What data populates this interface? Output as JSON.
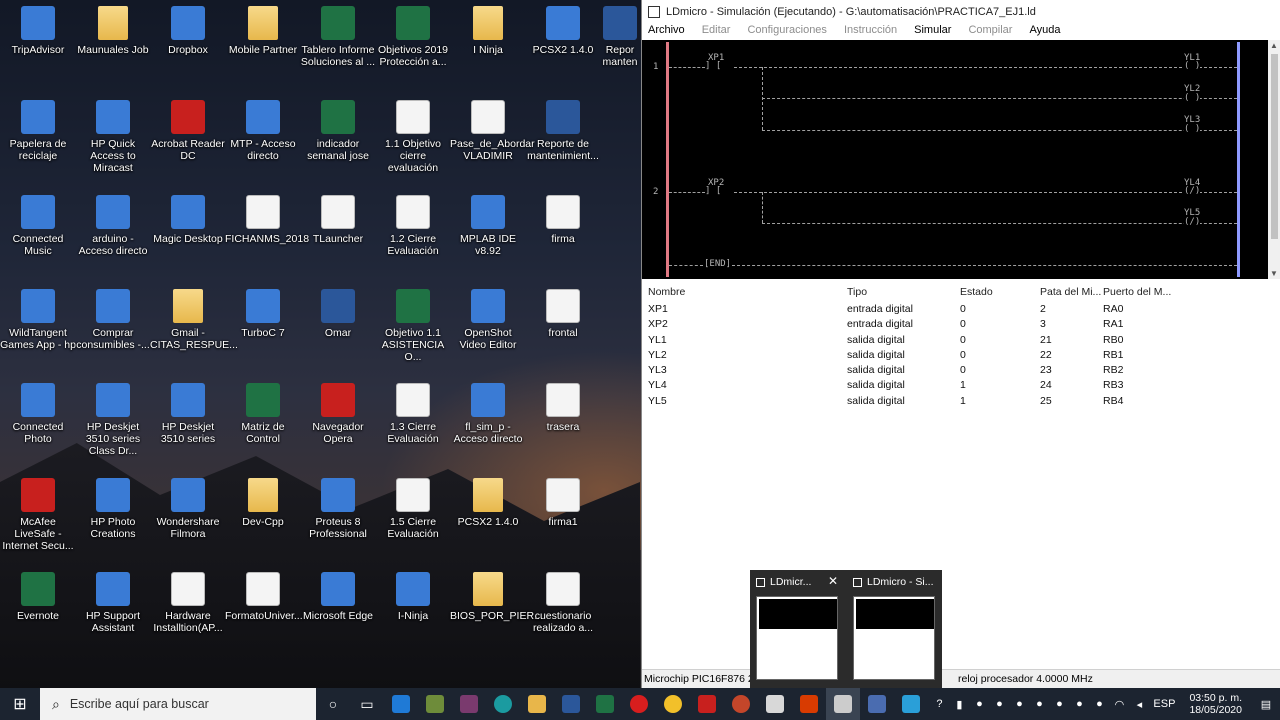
{
  "desktop": {
    "icons": [
      {
        "label": "TripAdvisor"
      },
      {
        "label": "Maunuales Job"
      },
      {
        "label": "Dropbox"
      },
      {
        "label": "Mobile Partner"
      },
      {
        "label": "Tablero Informe Soluciones al ..."
      },
      {
        "label": "Objetivos 2019 Protección a..."
      },
      {
        "label": "I Ninja"
      },
      {
        "label": "PCSX2 1.4.0"
      },
      {
        "label": "Repor manten"
      },
      {
        "label": "Papelera de reciclaje"
      },
      {
        "label": "HP Quick Access to Miracast"
      },
      {
        "label": "Acrobat Reader DC"
      },
      {
        "label": "MTP - Acceso directo"
      },
      {
        "label": "indicador semanal jose"
      },
      {
        "label": "1.1 Objetivo cierre evaluación"
      },
      {
        "label": "Pase_de_Abordar VLADIMIR"
      },
      {
        "label": "Reporte de mantenimient..."
      },
      {
        "label": "Connected Music"
      },
      {
        "label": "arduino - Acceso directo"
      },
      {
        "label": "Magic Desktop"
      },
      {
        "label": "FICHANMS_2018"
      },
      {
        "label": "TLauncher"
      },
      {
        "label": "1.2 Cierre Evaluación"
      },
      {
        "label": "MPLAB IDE v8.92"
      },
      {
        "label": "firma"
      },
      {
        "label": "WildTangent Games App - hp"
      },
      {
        "label": "Comprar consumibles -..."
      },
      {
        "label": "Gmail - CITAS_RESPUE..."
      },
      {
        "label": "TurboC 7"
      },
      {
        "label": "Omar"
      },
      {
        "label": "Objetivo 1.1 ASISTENCIA O..."
      },
      {
        "label": "OpenShot Video Editor"
      },
      {
        "label": "frontal"
      },
      {
        "label": "Connected Photo"
      },
      {
        "label": "HP Deskjet 3510 series Class Dr..."
      },
      {
        "label": "HP Deskjet 3510 series"
      },
      {
        "label": "Matriz de Control"
      },
      {
        "label": "Navegador Opera"
      },
      {
        "label": "1.3 Cierre Evaluación"
      },
      {
        "label": "fl_sim_p - Acceso directo"
      },
      {
        "label": "trasera"
      },
      {
        "label": "McAfee LiveSafe - Internet Secu..."
      },
      {
        "label": "HP Photo Creations"
      },
      {
        "label": "Wondershare Filmora"
      },
      {
        "label": "Dev-Cpp"
      },
      {
        "label": "Proteus 8 Professional"
      },
      {
        "label": "1.5 Cierre Evaluación"
      },
      {
        "label": "PCSX2 1.4.0"
      },
      {
        "label": "firma1"
      },
      {
        "label": "Evernote"
      },
      {
        "label": "HP Support Assistant"
      },
      {
        "label": "Hardware Installtion(AP..."
      },
      {
        "label": "FormatoUniver..."
      },
      {
        "label": "Microsoft Edge"
      },
      {
        "label": "I-Ninja"
      },
      {
        "label": "BIOS_POR_PIER..."
      },
      {
        "label": "cuestionario realizado a..."
      }
    ]
  },
  "window": {
    "title": "LDmicro - Simulación (Ejecutando) - G:\\automatisación\\PRACTICA7_EJ1.ld",
    "menu": [
      "Archivo",
      "Editar",
      "Configuraciones",
      "Instrucción",
      "Simular",
      "Compilar",
      "Ayuda"
    ]
  },
  "ladder": {
    "rung1_num": "1",
    "rung2_num": "2",
    "xp1": "XP1",
    "xp2": "XP2",
    "contact_open": "]  [",
    "contact_open2": "]  [",
    "yl1": "YL1",
    "yl2": "YL2",
    "yl3": "YL3",
    "yl4": "YL4",
    "yl5": "YL5",
    "coil_off": "( )",
    "coil_off2": "( )",
    "coil_off3": "( )",
    "coil_on": "(/)",
    "coil_on2": "(/)",
    "end": "[END]"
  },
  "io_table": {
    "headers": [
      "Nombre",
      "Tipo",
      "Estado",
      "Pata del Mi...",
      "Puerto del M..."
    ],
    "rows": [
      {
        "nombre": "XP1",
        "tipo": "entrada digital",
        "estado": "0",
        "pata": "2",
        "puerto": "RA0"
      },
      {
        "nombre": "XP2",
        "tipo": "entrada digital",
        "estado": "0",
        "pata": "3",
        "puerto": "RA1"
      },
      {
        "nombre": "YL1",
        "tipo": "salida digital",
        "estado": "0",
        "pata": "21",
        "puerto": "RB0"
      },
      {
        "nombre": "YL2",
        "tipo": "salida digital",
        "estado": "0",
        "pata": "22",
        "puerto": "RB1"
      },
      {
        "nombre": "YL3",
        "tipo": "salida digital",
        "estado": "0",
        "pata": "23",
        "puerto": "RB2"
      },
      {
        "nombre": "YL4",
        "tipo": "salida digital",
        "estado": "1",
        "pata": "24",
        "puerto": "RB3"
      },
      {
        "nombre": "YL5",
        "tipo": "salida digital",
        "estado": "1",
        "pata": "25",
        "puerto": "RB4"
      }
    ]
  },
  "status": {
    "left": "Microchip PIC16F876 28-P",
    "right": "reloj procesador 4.0000 MHz"
  },
  "thumbnails": [
    {
      "title": "LDmicr..."
    },
    {
      "title": "LDmicro - Si..."
    }
  ],
  "taskbar": {
    "search_placeholder": "Escribe aquí para buscar",
    "lang": "ESP",
    "time": "03:50 p. m.",
    "date": "18/05/2020"
  }
}
